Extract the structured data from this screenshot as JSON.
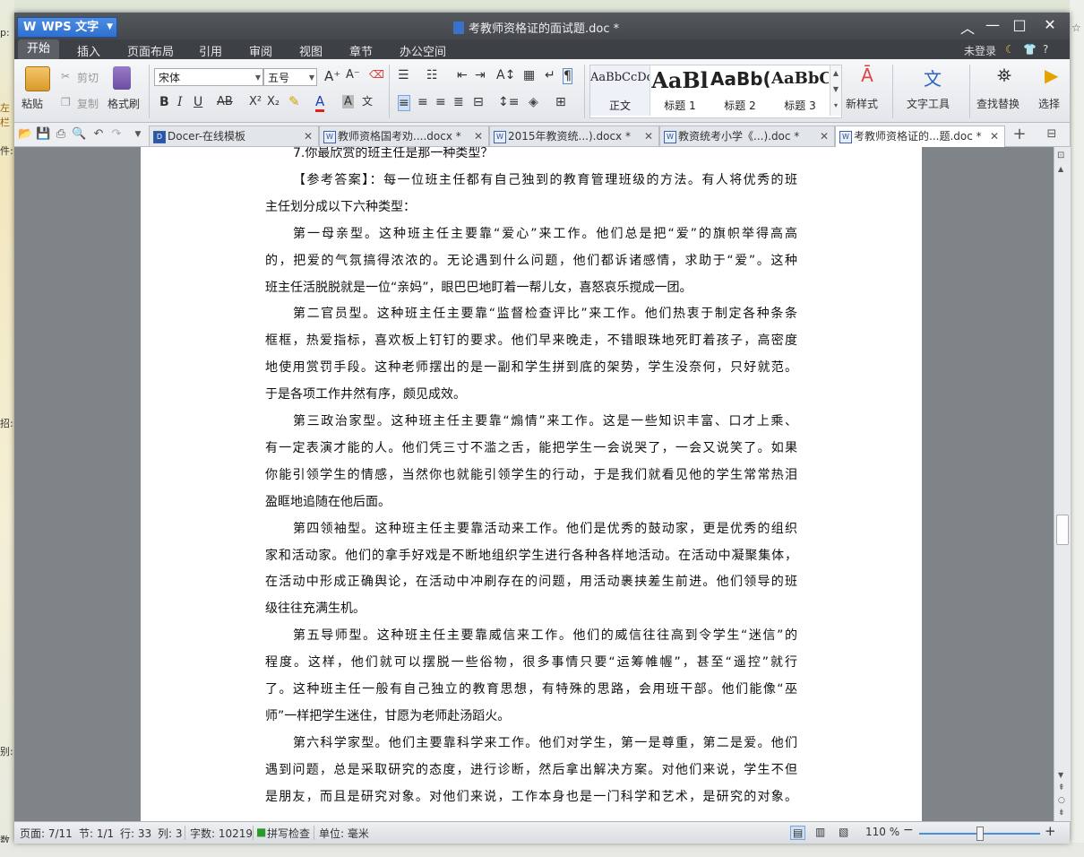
{
  "background": {
    "left_labels": [
      "p:",
      "左栏",
      "件:",
      "招:",
      "别:",
      "数"
    ],
    "right_labels": [
      "☆"
    ]
  },
  "titlebar": {
    "app_name": "WPS 文字",
    "app_letter": "W",
    "doc_title": "考教师资格证的面试题.doc *"
  },
  "menu": {
    "items": [
      "开始",
      "插入",
      "页面布局",
      "引用",
      "审阅",
      "视图",
      "章节",
      "办公空间"
    ],
    "login": "未登录",
    "help": "?"
  },
  "ribbon": {
    "paste": "粘贴",
    "cut": "剪切",
    "copy": "复制",
    "format_painter": "格式刷",
    "font_name": "宋体",
    "font_size": "五号",
    "styles": [
      {
        "sample": "AaBbCcDd",
        "label": "正文"
      },
      {
        "sample": "AaBl",
        "label": "标题 1"
      },
      {
        "sample": "AaBb(",
        "label": "标题 2"
      },
      {
        "sample": "AaBbC",
        "label": "标题 3"
      }
    ],
    "new_style": "新样式",
    "text_tools": "文字工具",
    "find_replace": "查找替换",
    "select": "选择"
  },
  "tabs": [
    {
      "title": "Docer-在线模板",
      "icon": "D"
    },
    {
      "title": "教师资格国考劝....docx *",
      "icon": "W"
    },
    {
      "title": "2015年教资统...).docx *",
      "icon": "W"
    },
    {
      "title": "教资统考小学《...).doc *",
      "icon": "W"
    },
    {
      "title": "考教师资格证的...题.doc *",
      "icon": "W"
    }
  ],
  "document": {
    "lines": [
      "7.你最欣赏的班主任是那一种类型？",
      "【参考答案】：每一位班主任都有自己独到的教育管理班级的方法。有人将优秀的班",
      "主任划分成以下六种类型：",
      "第一母亲型。这种班主任主要靠“爱心”来工作。他们总是把“爱”的旗帜举得高高",
      "的，把爱的气氛搞得浓浓的。无论遇到什么问题，他们都诉诸感情，求助于“爱”。这种",
      "班主任活脱脱就是一位“亲妈”，眼巴巴地盯着一帮儿女，喜怒哀乐搅成一团。",
      "第二官员型。这种班主任主要靠“监督检查评比”来工作。他们热衷于制定各种条条",
      "框框，热爱指标，喜欢板上钉钉的要求。他们早来晚走，不错眼珠地死盯着孩子，高密度",
      "地使用赏罚手段。这种老师摆出的是一副和学生拼到底的架势，学生没奈何，只好就范。",
      "于是各项工作井然有序，颇见成效。",
      "第三政治家型。这种班主任主要靠“煽情”来工作。这是一些知识丰富、口才上乘、",
      "有一定表演才能的人。他们凭三寸不滥之舌，能把学生一会说哭了，一会又说笑了。如果",
      "你能引领学生的情感，当然你也就能引领学生的行动，于是我们就看见他的学生常常热泪",
      "盈眶地追随在他后面。",
      "第四领袖型。这种班主任主要靠活动来工作。他们是优秀的鼓动家，更是优秀的组织",
      "家和活动家。他们的拿手好戏是不断地组织学生进行各种各样地活动。在活动中凝聚集体，",
      "在活动中形成正确舆论，在活动中冲刷存在的问题，用活动裹挟差生前进。他们领导的班",
      "级往往充满生机。",
      "第五导师型。这种班主任主要靠威信来工作。他们的威信往往高到令学生“迷信”的",
      "程度。这样，他们就可以摆脱一些俗物，很多事情只要“运筹帷幄”，甚至“遥控”就行",
      "了。这种班主任一般有自己独立的教育思想，有特殊的思路，会用班干部。他们能像“巫",
      "师”一样把学生迷住，甘愿为老师赴汤蹈火。",
      "第六科学家型。他们主要靠科学来工作。他们对学生，第一是尊重，第二是爱。他们",
      "遇到问题，总是采取研究的态度，进行诊断，然后拿出解决方案。对他们来说，学生不但",
      "是朋友，而且是研究对象。对他们来说，工作本身也是一门科学和艺术，是研究的对象。"
    ]
  },
  "status": {
    "page": "页面: 7/11",
    "section": "节: 1/1",
    "row": "行: 33",
    "col": "列: 3",
    "words": "字数: 10219",
    "spell": "拼写检查",
    "unit": "单位: 毫米",
    "zoom": "110 %",
    "zoom_value": 110
  }
}
